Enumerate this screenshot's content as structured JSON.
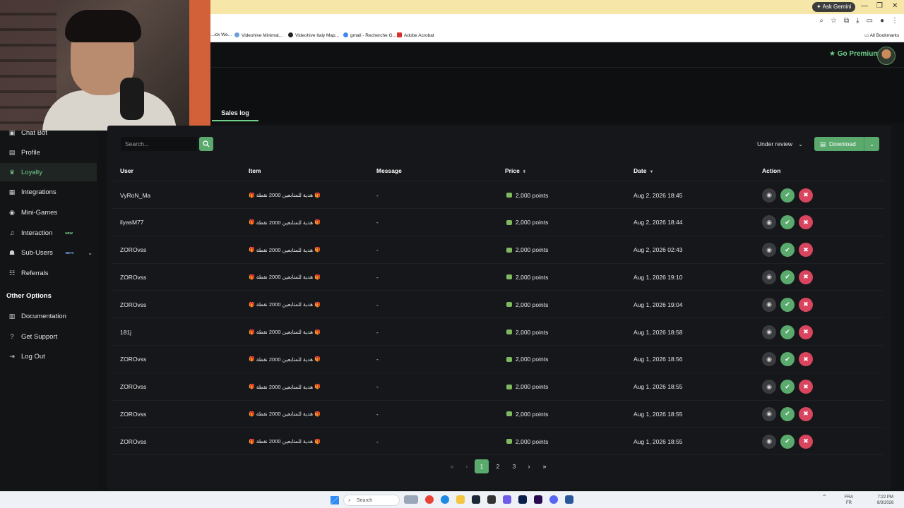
{
  "browser": {
    "ask_gemini": "Ask Gemini",
    "bookmarks": [
      "...ick We...",
      "Videohive Minimal...",
      "Videohive Italy Map...",
      "gmail - Recherche G...",
      "Adobe Acrobat"
    ],
    "all_bookmarks": "All Bookmarks"
  },
  "header": {
    "go_premium": "Go Premium"
  },
  "sidebar": {
    "items": [
      {
        "label": "Chat Bot",
        "icon": "chat-bot-icon"
      },
      {
        "label": "Profile",
        "icon": "profile-icon"
      },
      {
        "label": "Loyalty",
        "icon": "trophy-icon",
        "active": true
      },
      {
        "label": "Integrations",
        "icon": "integrations-icon"
      },
      {
        "label": "Mini-Games",
        "icon": "gamepad-icon"
      },
      {
        "label": "Interaction",
        "icon": "music-icon",
        "badge": "NEW"
      },
      {
        "label": "Sub-Users",
        "icon": "users-icon",
        "badge": "BETA"
      },
      {
        "label": "Referrals",
        "icon": "referrals-icon"
      }
    ],
    "section_title": "Other Options",
    "other_items": [
      {
        "label": "Documentation",
        "icon": "book-icon"
      },
      {
        "label": "Get Support",
        "icon": "help-icon"
      },
      {
        "label": "Log Out",
        "icon": "logout-icon"
      }
    ]
  },
  "main": {
    "tab": "Sales log",
    "search_placeholder": "Search...",
    "filter_value": "Under review",
    "download_label": "Download",
    "columns": {
      "user": "User",
      "item": "Item",
      "message": "Message",
      "price": "Price",
      "date": "Date",
      "action": "Action"
    },
    "rows": [
      {
        "user": "VyRoN_Ma",
        "item": "هدية للمتابعين 2000 نقطة",
        "message": "-",
        "price": "2,000 points",
        "date": "Aug 2, 2026 18:45"
      },
      {
        "user": "ilyasM77",
        "item": "هدية للمتابعين 2000 نقطة",
        "message": "-",
        "price": "2,000 points",
        "date": "Aug 2, 2026 18:44"
      },
      {
        "user": "ZOROvss",
        "item": "هدية للمتابعين 2000 نقطة",
        "message": "-",
        "price": "2,000 points",
        "date": "Aug 2, 2026 02:43"
      },
      {
        "user": "ZOROvss",
        "item": "هدية للمتابعين 2000 نقطة",
        "message": "-",
        "price": "2,000 points",
        "date": "Aug 1, 2026 19:10"
      },
      {
        "user": "ZOROvss",
        "item": "هدية للمتابعين 2000 نقطة",
        "message": "-",
        "price": "2,000 points",
        "date": "Aug 1, 2026 19:04"
      },
      {
        "user": "181j",
        "item": "هدية للمتابعين 2000 نقطة",
        "message": "-",
        "price": "2,000 points",
        "date": "Aug 1, 2026 18:58"
      },
      {
        "user": "ZOROvss",
        "item": "هدية للمتابعين 2000 نقطة",
        "message": "-",
        "price": "2,000 points",
        "date": "Aug 1, 2026 18:56"
      },
      {
        "user": "ZOROvss",
        "item": "هدية للمتابعين 2000 نقطة",
        "message": "-",
        "price": "2,000 points",
        "date": "Aug 1, 2026 18:55"
      },
      {
        "user": "ZOROvss",
        "item": "هدية للمتابعين 2000 نقطة",
        "message": "-",
        "price": "2,000 points",
        "date": "Aug 1, 2026 18:55"
      },
      {
        "user": "ZOROvss",
        "item": "هدية للمتابعين 2000 نقطة",
        "message": "-",
        "price": "2,000 points",
        "date": "Aug 1, 2026 18:55"
      }
    ],
    "pagination": {
      "pages": [
        "1",
        "2",
        "3"
      ],
      "current": "1"
    }
  },
  "taskbar": {
    "search": "Search",
    "lang": "FRA",
    "lang_sub": "FR",
    "time": "7:22 PM",
    "date": "8/3/2026"
  },
  "colors": {
    "accent": "#5aa96d",
    "danger": "#d9455e",
    "background": "#111214"
  }
}
